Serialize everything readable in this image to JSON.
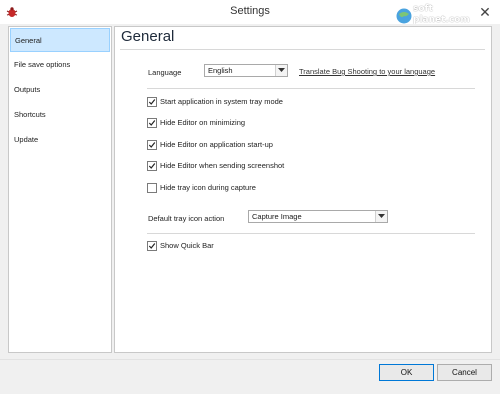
{
  "window": {
    "title": "Settings"
  },
  "watermark": {
    "line1": "soft",
    "line2": "planet.com",
    "icon": "globe-icon"
  },
  "sidebar": {
    "items": [
      {
        "label": "General",
        "active": true
      },
      {
        "label": "File save options",
        "active": false
      },
      {
        "label": "Outputs",
        "active": false
      },
      {
        "label": "Shortcuts",
        "active": false
      },
      {
        "label": "Update",
        "active": false
      }
    ]
  },
  "general": {
    "heading": "General",
    "language_label": "Language",
    "language_value": "English",
    "translate_link": "Translate Bug Shooting to your language",
    "options": [
      {
        "label": "Start application in system tray mode",
        "checked": true
      },
      {
        "label": "Hide Editor on minimizing",
        "checked": true
      },
      {
        "label": "Hide Editor on application start-up",
        "checked": true
      },
      {
        "label": "Hide Editor when sending screenshot",
        "checked": true
      },
      {
        "label": "Hide tray icon during capture",
        "checked": false
      }
    ],
    "tray_action_label": "Default tray icon action",
    "tray_action_value": "Capture Image",
    "quick_bar": {
      "label": "Show Quick Bar",
      "checked": true
    }
  },
  "footer": {
    "ok_label": "OK",
    "cancel_label": "Cancel"
  },
  "colors": {
    "selection_bg": "#cde8ff",
    "selection_border": "#99d1ff",
    "default_button_border": "#0078d7"
  }
}
